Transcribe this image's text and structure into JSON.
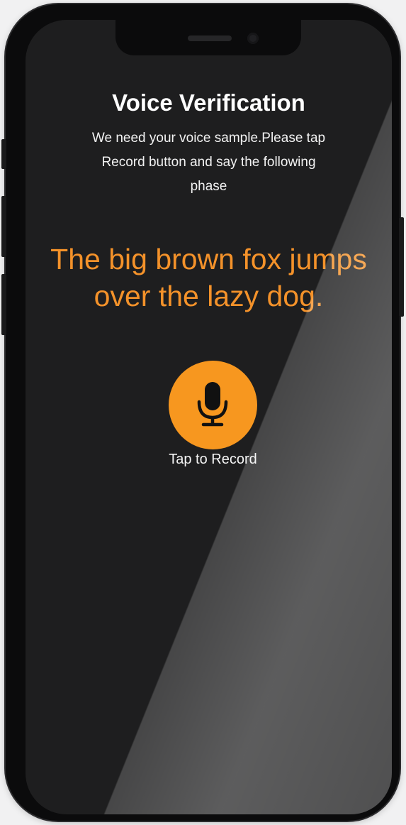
{
  "screen": {
    "title": "Voice Verification",
    "instructions": "We need your voice sample.Please tap Record button and say the following phase",
    "phrase": "The big brown fox jumps over the lazy dog.",
    "record": {
      "icon": "microphone-icon",
      "label": "Tap to Record"
    }
  },
  "colors": {
    "accent": "#f7971f",
    "phrase_text": "#f4922a",
    "screen_background": "#1e1e1f",
    "text": "#ffffff"
  }
}
